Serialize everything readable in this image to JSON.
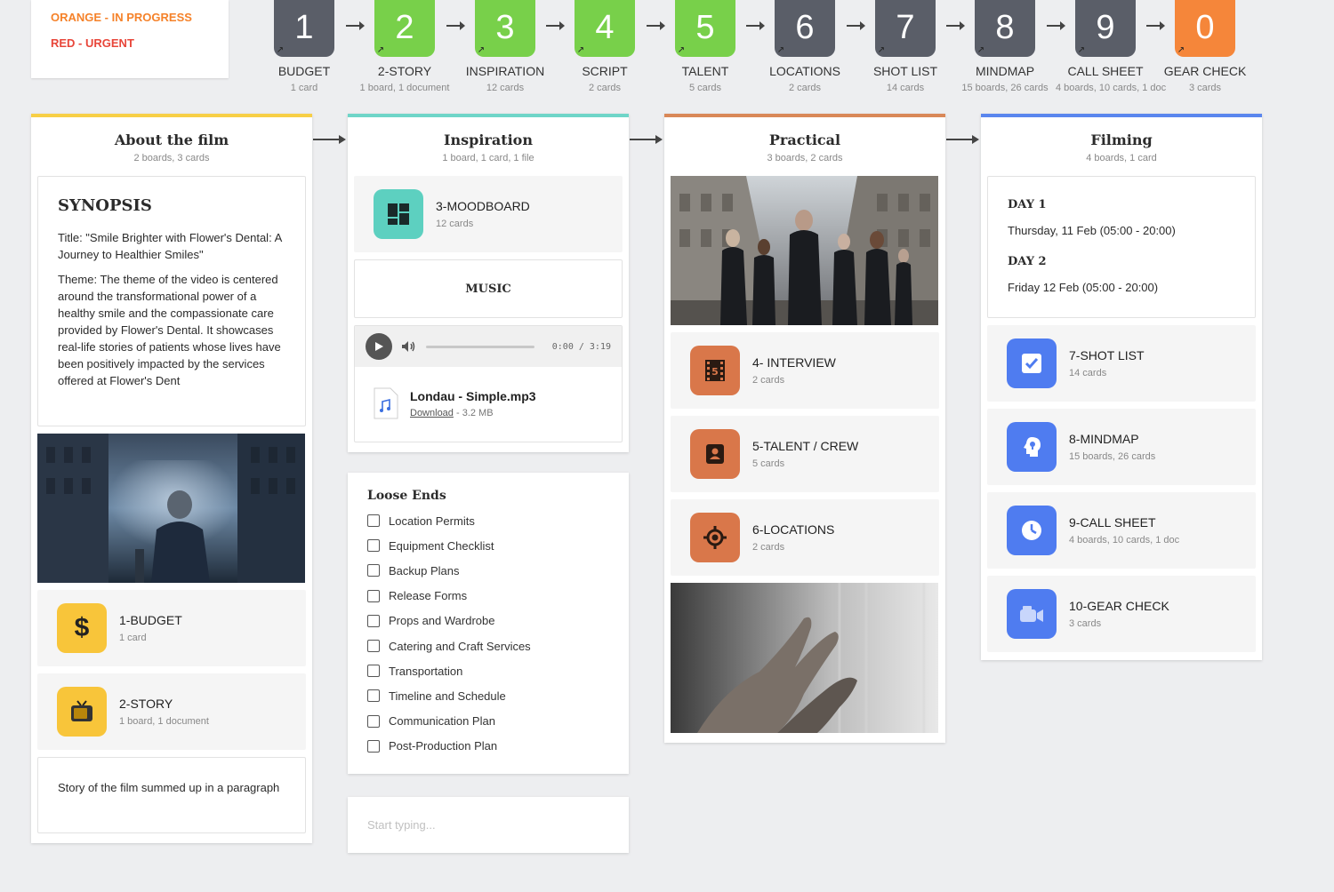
{
  "legend": {
    "orange": "ORANGE - IN PROGRESS",
    "red": "RED - URGENT",
    "orange_color": "#f5822a",
    "red_color": "#e8463a"
  },
  "steps": [
    {
      "num": "1",
      "label": "BUDGET",
      "sub": "1 card",
      "color": "#5a5e68"
    },
    {
      "num": "2",
      "label": "2-STORY",
      "sub": "1 board, 1 document",
      "color": "#78d04a"
    },
    {
      "num": "3",
      "label": "INSPIRATION",
      "sub": "12 cards",
      "color": "#78d04a"
    },
    {
      "num": "4",
      "label": "SCRIPT",
      "sub": "2 cards",
      "color": "#78d04a"
    },
    {
      "num": "5",
      "label": "TALENT",
      "sub": "5 cards",
      "color": "#78d04a"
    },
    {
      "num": "6",
      "label": "LOCATIONS",
      "sub": "2 cards",
      "color": "#5a5e68"
    },
    {
      "num": "7",
      "label": "SHOT LIST",
      "sub": "14 cards",
      "color": "#5a5e68"
    },
    {
      "num": "8",
      "label": "MINDMAP",
      "sub": "15 boards, 26 cards",
      "color": "#5a5e68"
    },
    {
      "num": "9",
      "label": "CALL SHEET",
      "sub": "4 boards, 10 cards, 1 doc",
      "color": "#5a5e68"
    },
    {
      "num": "0",
      "label": "GEAR CHECK",
      "sub": "3 cards",
      "color": "#f5863a"
    }
  ],
  "about": {
    "title": "About the film",
    "sub": "2 boards, 3 cards",
    "synopsis_heading": "SYNOPSIS",
    "synopsis_title": "Title: \"Smile Brighter with Flower's Dental: A Journey to Healthier Smiles\"",
    "synopsis_theme": "Theme: The theme of the video is centered around the transformational power of a healthy smile and the compassionate care provided by Flower's Dental. It showcases real-life stories of patients whose lives have been positively impacted by the services offered at Flower's Dent",
    "budget": {
      "title": "1-BUDGET",
      "sub": "1 card"
    },
    "story": {
      "title": "2-STORY",
      "sub": "1 board, 1 document"
    },
    "summary": "Story of the film summed up in a paragraph"
  },
  "inspiration": {
    "title": "Inspiration",
    "sub": "1 board, 1 card, 1 file",
    "moodboard": {
      "title": "3-MOODBOARD",
      "sub": "12 cards"
    },
    "music_heading": "MUSIC",
    "player_time": "0:00 / 3:19",
    "file": {
      "name": "Londau - Simple.mp3",
      "download": "Download",
      "size": " - 3.2 MB"
    }
  },
  "loose_ends": {
    "title": "Loose Ends",
    "items": [
      "Location Permits",
      "Equipment Checklist",
      "Backup Plans",
      "Release Forms",
      "Props and Wardrobe",
      "Catering and Craft Services",
      "Transportation",
      "Timeline and Schedule",
      "Communication Plan",
      "Post-Production Plan"
    ]
  },
  "typing_placeholder": "Start typing...",
  "practical": {
    "title": "Practical",
    "sub": "3 boards, 2 cards",
    "interview": {
      "title": "4- INTERVIEW",
      "sub": "2 cards"
    },
    "talent": {
      "title": "5-TALENT / CREW",
      "sub": "5 cards"
    },
    "locations": {
      "title": "6-LOCATIONS",
      "sub": "2 cards"
    }
  },
  "filming": {
    "title": "Filming",
    "sub": "4 boards, 1 card",
    "day1_heading": "DAY 1",
    "day1": "Thursday, 11 Feb (05:00 - 20:00)",
    "day2_heading": "DAY 2",
    "day2": "Friday 12 Feb (05:00 - 20:00)",
    "shotlist": {
      "title": "7-SHOT LIST",
      "sub": "14 cards"
    },
    "mindmap": {
      "title": "8-MINDMAP",
      "sub": "15 boards, 26 cards"
    },
    "callsheet": {
      "title": "9-CALL SHEET",
      "sub": "4 boards, 10 cards, 1 doc"
    },
    "gearcheck": {
      "title": "10-GEAR CHECK",
      "sub": "3 cards"
    }
  },
  "colors": {
    "about_bar": "#f7cf46",
    "inspiration_bar": "#6fd5c8",
    "practical_bar": "#d98858",
    "filming_bar": "#5a86ee",
    "yellow_icon": "#f8c53a",
    "teal_icon": "#5dd0c0",
    "orange_icon": "#d9774a",
    "blue_icon": "#4f7cf0"
  }
}
